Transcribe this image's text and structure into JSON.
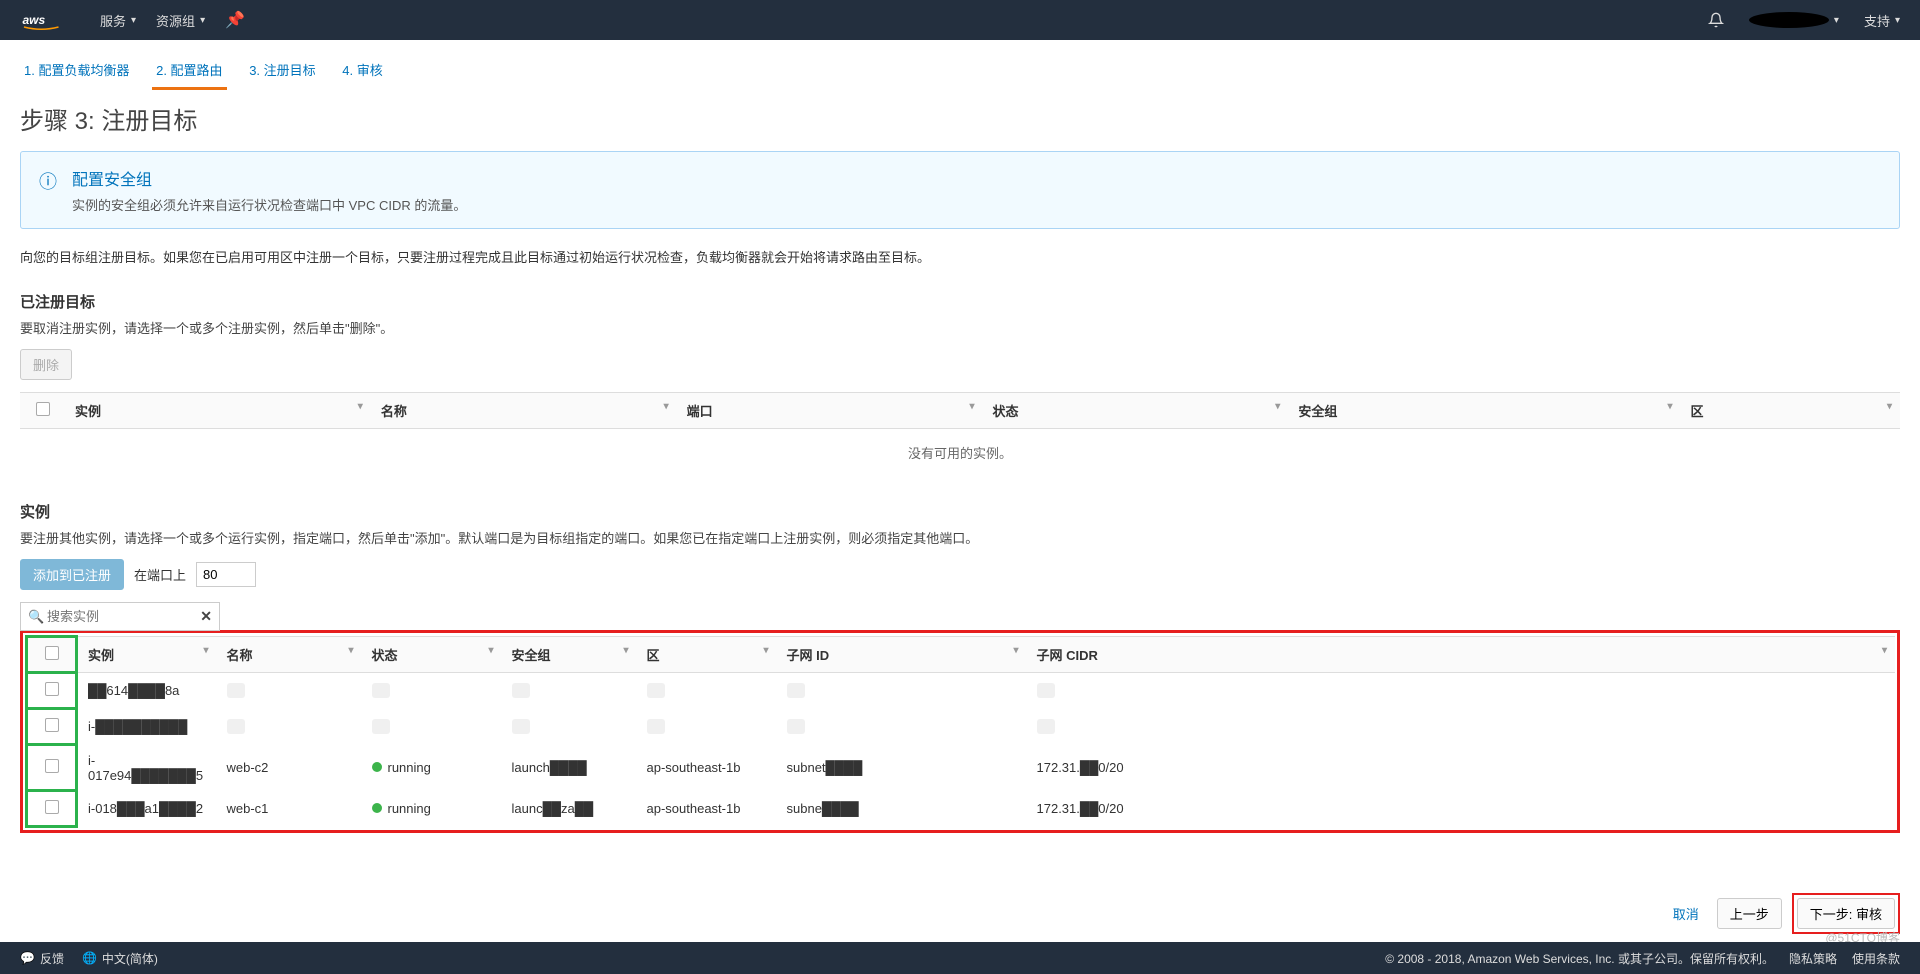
{
  "nav": {
    "services": "服务",
    "resource_groups": "资源组",
    "support": "支持"
  },
  "steps": [
    "1. 配置负载均衡器",
    "2. 配置路由",
    "3. 注册目标",
    "4. 审核"
  ],
  "page_title": "步骤 3: 注册目标",
  "info": {
    "title": "配置安全组",
    "text": "实例的安全组必须允许来自运行状况检查端口中 VPC CIDR 的流量。"
  },
  "desc": "向您的目标组注册目标。如果您在已启用可用区中注册一个目标，只要注册过程完成且此目标通过初始运行状况检查，负载均衡器就会开始将请求路由至目标。",
  "registered": {
    "title": "已注册目标",
    "desc": "要取消注册实例，请选择一个或多个注册实例，然后单击\"删除\"。",
    "delete_btn": "删除",
    "headers": [
      "实例",
      "名称",
      "端口",
      "状态",
      "安全组",
      "区"
    ],
    "empty": "没有可用的实例。"
  },
  "instances": {
    "title": "实例",
    "desc": "要注册其他实例，请选择一个或多个运行实例，指定端口，然后单击\"添加\"。默认端口是为目标组指定的端口。如果您已在指定端口上注册实例，则必须指定其他端口。",
    "add_btn": "添加到已注册",
    "port_label": "在端口上",
    "port_value": "80",
    "search_placeholder": "搜索实例",
    "headers": [
      "实例",
      "名称",
      "状态",
      "安全组",
      "区",
      "子网 ID",
      "子网 CIDR"
    ],
    "rows": [
      {
        "id": "██614████8a",
        "name": "██",
        "status": "██",
        "sg": "██",
        "zone": "██",
        "subnet": "██",
        "cidr": "██"
      },
      {
        "id": "i-██████████",
        "name": "██",
        "status": "██",
        "sg": "██",
        "zone": "██",
        "subnet": "██",
        "cidr": "██"
      },
      {
        "id": "i-017e94███████5",
        "name": "web-c2",
        "status": "running",
        "sg": "launch████",
        "zone": "ap-southeast-1b",
        "subnet": "subnet████",
        "cidr": "172.31.██0/20"
      },
      {
        "id": "i-018███a1████2",
        "name": "web-c1",
        "status": "running",
        "sg": "launc██za██",
        "zone": "ap-southeast-1b",
        "subnet": "subne████",
        "cidr": "172.31.██0/20"
      }
    ]
  },
  "footer": {
    "cancel": "取消",
    "prev": "上一步",
    "next": "下一步: 审核"
  },
  "bottom": {
    "feedback": "反馈",
    "language": "中文(简体)",
    "copyright": "© 2008 - 2018, Amazon Web Services, Inc. 或其子公司。保留所有权利。",
    "privacy": "隐私策略",
    "terms": "使用条款"
  },
  "watermark": "@51CTO博客"
}
